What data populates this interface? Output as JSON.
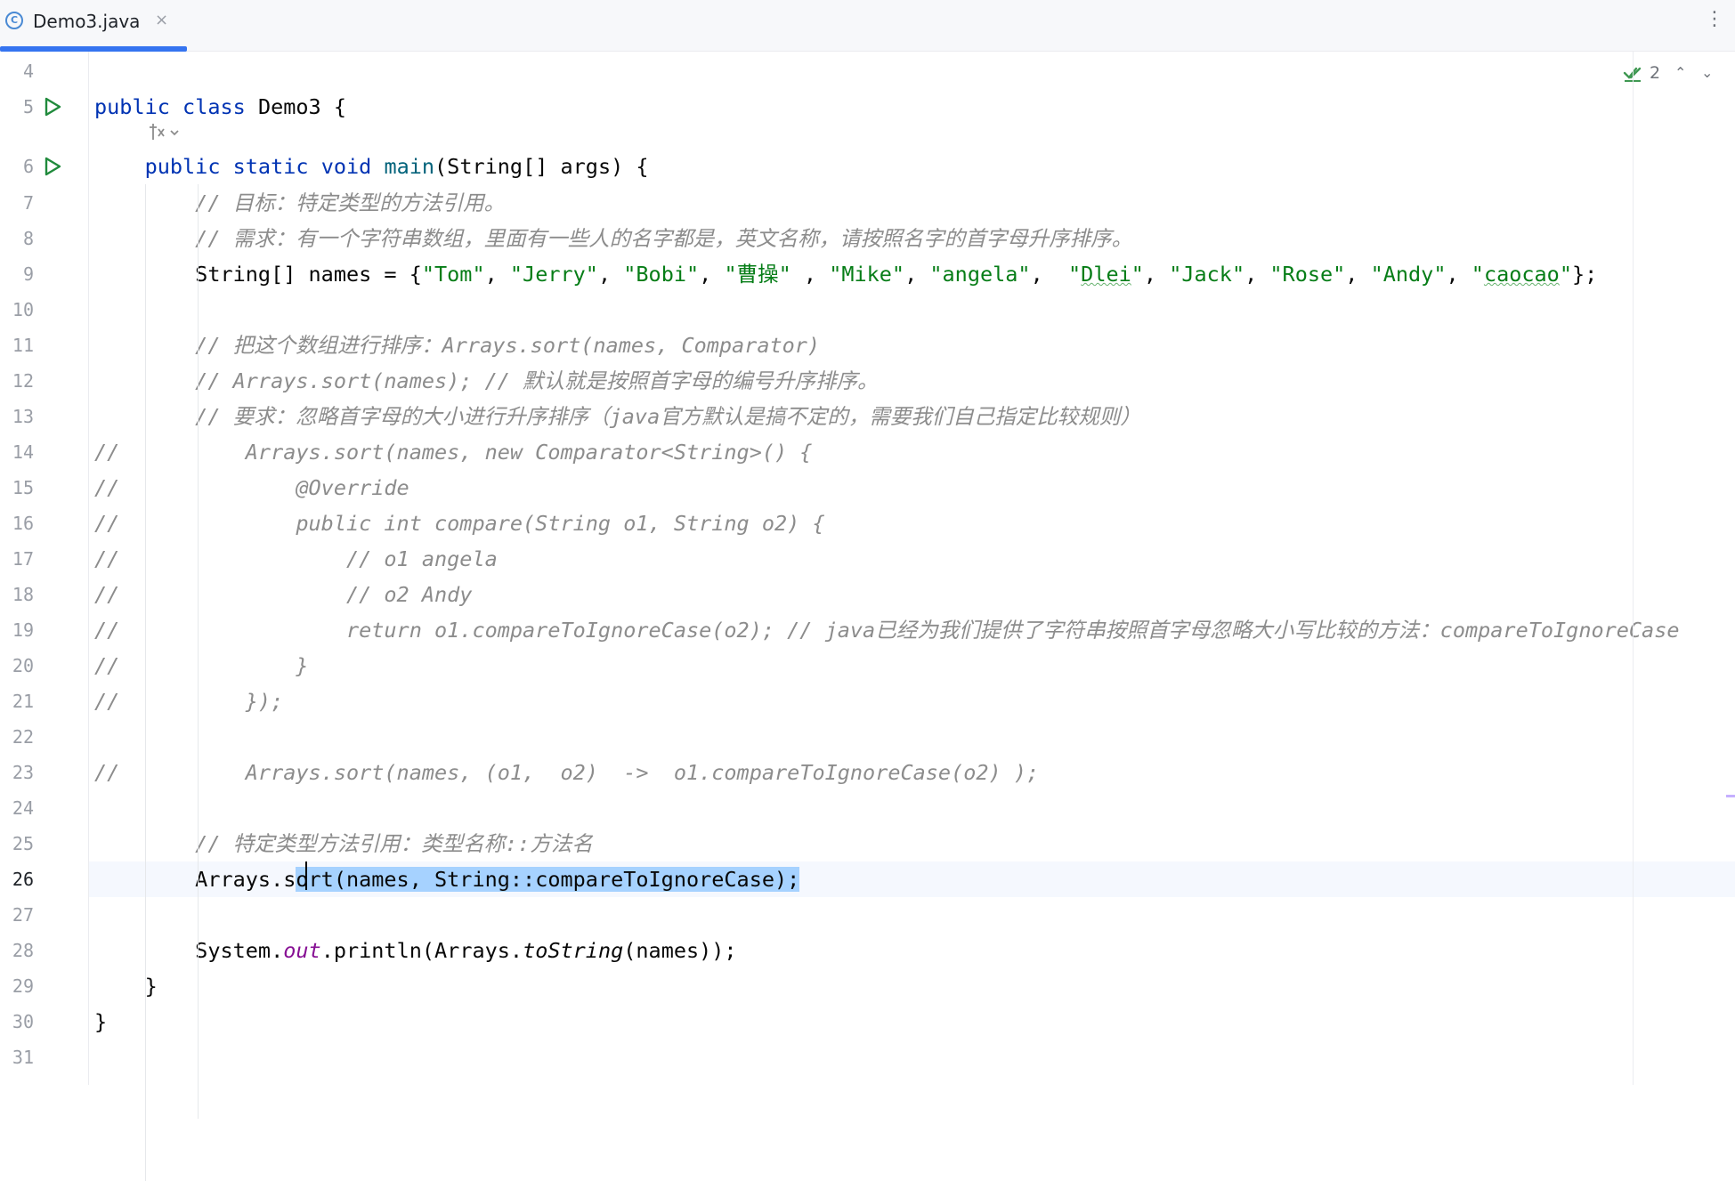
{
  "tab": {
    "title": "Demo3.java",
    "close_glyph": "×",
    "menu_glyph": "⋮",
    "icon": "class-c-icon"
  },
  "inspection": {
    "count": "2",
    "up_glyph": "⌃",
    "down_glyph": "⌄"
  },
  "editor": {
    "current_line": 26,
    "lines": [
      {
        "n": "4",
        "text": ""
      },
      {
        "n": "5",
        "text": "public class Demo3 {"
      },
      {
        "n": "",
        "text": ""
      },
      {
        "n": "6",
        "text": "    public static void main(String[] args) {"
      },
      {
        "n": "7",
        "text": "        // 目标：特定类型的方法引用。"
      },
      {
        "n": "8",
        "text": "        // 需求：有一个字符串数组，里面有一些人的名字都是，英文名称，请按照名字的首字母升序排序。"
      },
      {
        "n": "9",
        "text": "        String[] names = {\"Tom\", \"Jerry\", \"Bobi\", \"曹操\" , \"Mike\", \"angela\",  \"Dlei\", \"Jack\", \"Rose\", \"Andy\", \"caocao\"};"
      },
      {
        "n": "10",
        "text": ""
      },
      {
        "n": "11",
        "text": "        // 把这个数组进行排序：Arrays.sort(names, Comparator)"
      },
      {
        "n": "12",
        "text": "        // Arrays.sort(names); // 默认就是按照首字母的编号升序排序。"
      },
      {
        "n": "13",
        "text": "        // 要求：忽略首字母的大小进行升序排序（java官方默认是搞不定的，需要我们自己指定比较规则）"
      },
      {
        "n": "14",
        "text": "//          Arrays.sort(names, new Comparator<String>() {"
      },
      {
        "n": "15",
        "text": "//              @Override"
      },
      {
        "n": "16",
        "text": "//              public int compare(String o1, String o2) {"
      },
      {
        "n": "17",
        "text": "//                  // o1 angela"
      },
      {
        "n": "18",
        "text": "//                  // o2 Andy"
      },
      {
        "n": "19",
        "text": "//                  return o1.compareToIgnoreCase(o2); // java已经为我们提供了字符串按照首字母忽略大小写比较的方法：compareToIgnoreCase"
      },
      {
        "n": "20",
        "text": "//              }"
      },
      {
        "n": "21",
        "text": "//          });"
      },
      {
        "n": "22",
        "text": ""
      },
      {
        "n": "23",
        "text": "//          Arrays.sort(names, (o1,  o2)  ->  o1.compareToIgnoreCase(o2) );"
      },
      {
        "n": "24",
        "text": ""
      },
      {
        "n": "25",
        "text": "        // 特定类型方法引用：类型名称::方法名"
      },
      {
        "n": "26",
        "text": "        Arrays.sort(names, String::compareToIgnoreCase);"
      },
      {
        "n": "27",
        "text": ""
      },
      {
        "n": "28",
        "text": "        System.out.println(Arrays.toString(names));"
      },
      {
        "n": "29",
        "text": "    }"
      },
      {
        "n": "30",
        "text": "}"
      },
      {
        "n": "31",
        "text": ""
      }
    ]
  }
}
